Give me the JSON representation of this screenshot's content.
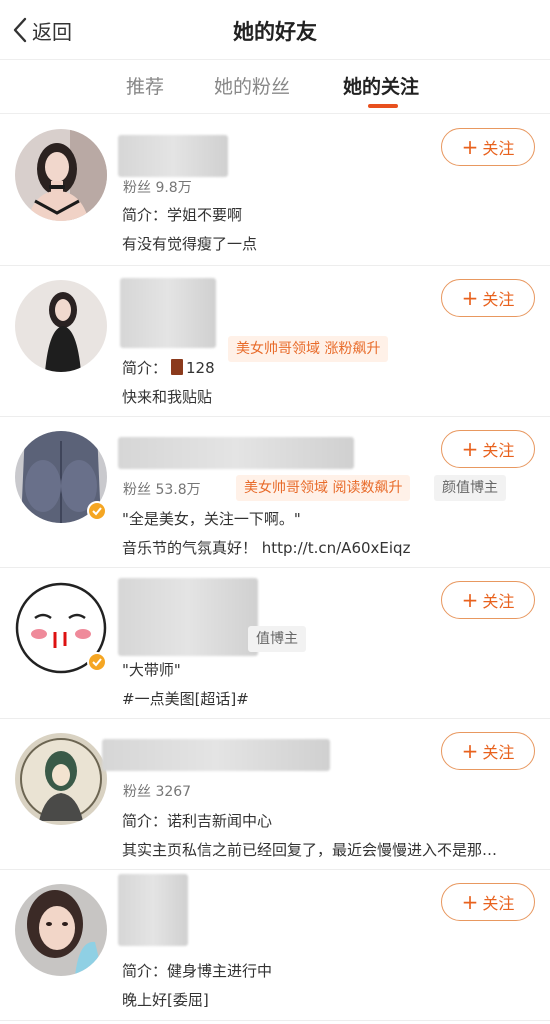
{
  "nav": {
    "back_label": "返回",
    "title": "她的好友"
  },
  "tabs": [
    {
      "label": "推荐",
      "active": false
    },
    {
      "label": "她的粉丝",
      "active": false
    },
    {
      "label": "她的关注",
      "active": true
    }
  ],
  "accent_color": "#e8501e",
  "follow_label": "关注",
  "users": [
    {
      "fans": "粉丝 9.8万",
      "intro": "简介：学姐不要啊",
      "desc": "有没有觉得瘦了一点",
      "tags": [],
      "verified": false
    },
    {
      "fans": "",
      "tags_text": "美女帅哥领域 涨粉飙升",
      "intro": "简介：",
      "intro_count": "128",
      "desc": "快来和我贴贴",
      "verified": false
    },
    {
      "fans": "粉丝 53.8万",
      "tag1": "美女帅哥领域 阅读数飙升",
      "tag2": "颜值博主",
      "intro": "\"全是美女，关注一下啊。\"",
      "desc": "音乐节的气氛真好！ http://t.cn/A60xEiqz",
      "verified": true
    },
    {
      "tag_partial": "值博主",
      "intro": "\"大带师\"",
      "desc": "#一点美图[超话]#",
      "verified": true
    },
    {
      "fans": "粉丝 3267",
      "intro": "简介：诺利吉新闻中心",
      "desc": "其实主页私信之前已经回复了，最近会慢慢进入不是那…",
      "verified": false
    },
    {
      "fans": "",
      "intro": "简介：健身博主进行中",
      "desc": "晚上好[委屈]",
      "verified": false
    }
  ]
}
